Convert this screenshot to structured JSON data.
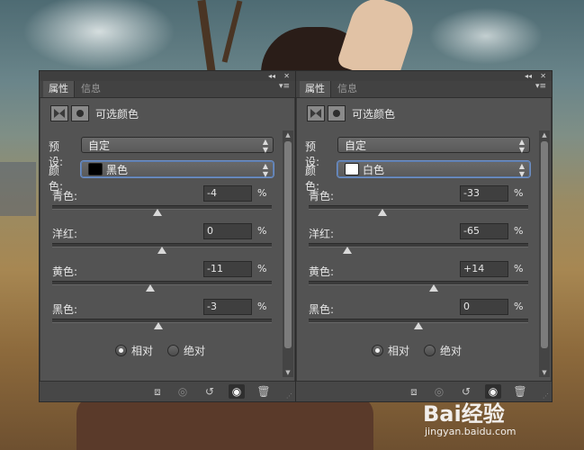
{
  "panels": [
    {
      "tabs": [
        "属性",
        "信息"
      ],
      "title": "可选颜色",
      "preset_label": "预设:",
      "preset_value": "自定",
      "color_label": "颜色:",
      "color_value": "黑色",
      "color_swatch": "#000000",
      "sliders": [
        {
          "label": "青色:",
          "value": "-4",
          "unit": "%",
          "level": 0.48
        },
        {
          "label": "洋红:",
          "value": "0",
          "unit": "%",
          "level": 0.5
        },
        {
          "label": "黄色:",
          "value": "-11",
          "unit": "%",
          "level": 0.445
        },
        {
          "label": "黑色:",
          "value": "-3",
          "unit": "%",
          "level": 0.485
        }
      ],
      "radio_relative": "相对",
      "radio_absolute": "绝对",
      "selected_mode": "相对"
    },
    {
      "tabs": [
        "属性",
        "信息"
      ],
      "title": "可选颜色",
      "preset_label": "预设:",
      "preset_value": "自定",
      "color_label": "颜色:",
      "color_value": "白色",
      "color_swatch": "#ffffff",
      "sliders": [
        {
          "label": "青色:",
          "value": "-33",
          "unit": "%",
          "level": 0.335
        },
        {
          "label": "洋红:",
          "value": "-65",
          "unit": "%",
          "level": 0.175
        },
        {
          "label": "黄色:",
          "value": "+14",
          "unit": "%",
          "level": 0.57
        },
        {
          "label": "黑色:",
          "value": "0",
          "unit": "%",
          "level": 0.5
        }
      ],
      "radio_relative": "相对",
      "radio_absolute": "绝对",
      "selected_mode": "相对"
    }
  ],
  "watermark": {
    "brand": "Bai经验",
    "url": "jingyan.baidu.com"
  },
  "icons": {
    "panel_collapse": "double-chevron-right-icon",
    "panel_close": "close-icon",
    "panel_menu": "menu-icon",
    "clip": "clip-to-layer-icon",
    "view_previous": "view-previous-state-icon",
    "reset": "reset-icon",
    "visibility": "eye-icon",
    "delete": "trash-icon"
  }
}
